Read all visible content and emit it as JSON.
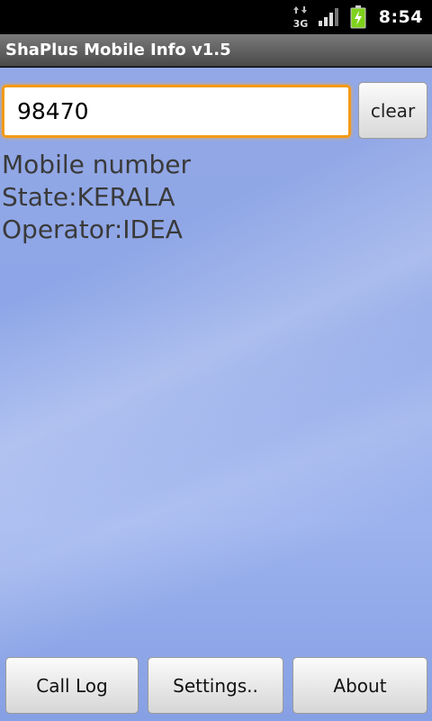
{
  "status_bar": {
    "network_type": "3G",
    "time": "8:54",
    "icons": [
      "data-transfer-icon",
      "signal-strength-icon",
      "battery-charging-icon"
    ]
  },
  "app": {
    "title": "ShaPlus Mobile Info v1.5"
  },
  "search": {
    "value": "98470",
    "clear_label": "clear"
  },
  "result": {
    "line1": "Mobile number",
    "line2": "State:KERALA",
    "line3": "Operator:IDEA"
  },
  "bottom_bar": {
    "call_log_label": "Call Log",
    "settings_label": "Settings..",
    "about_label": "About"
  },
  "colors": {
    "focus_border": "#f39a18",
    "battery_green": "#7fd11b",
    "background_blue": "#8ea6e7"
  }
}
